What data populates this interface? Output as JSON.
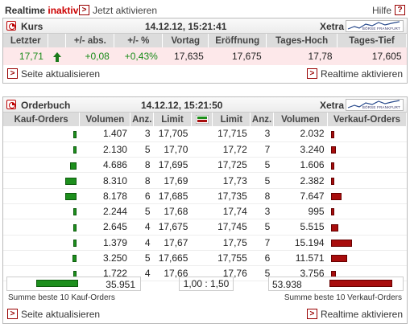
{
  "topbar": {
    "realtime_label": "Realtime",
    "inactive_label": "inaktiv",
    "activate_label": "Jetzt aktivieren",
    "help_label": "Hilfe"
  },
  "kurs": {
    "title": "Kurs",
    "timestamp": "14.12.12, 15:21:41",
    "exchange": "Xetra",
    "logo_text": "BÖRSE FRANKFURT",
    "headers": [
      "Letzter",
      "",
      "+/- abs.",
      "+/- %",
      "Vortag",
      "Eröffnung",
      "Tages-Hoch",
      "Tages-Tief"
    ],
    "values": {
      "last": "17,71",
      "change_abs": "+0,08",
      "change_pct": "+0,43%",
      "prev_close": "17,635",
      "open": "17,675",
      "high": "17,78",
      "low": "17,605"
    },
    "refresh_label": "Seite aktualisieren",
    "realtime_label": "Realtime aktivieren"
  },
  "orderbook": {
    "title": "Orderbuch",
    "timestamp": "14.12.12, 15:21:50",
    "exchange": "Xetra",
    "logo_text": "BÖRSE FRANKFURT",
    "headers": [
      "Kauf-Orders",
      "Volumen",
      "Anz.",
      "Limit",
      "",
      "Limit",
      "Anz.",
      "Volumen",
      "Verkauf-Orders"
    ],
    "rows": [
      {
        "bid_vol": "1.407",
        "bid_cnt": "3",
        "bid_limit": "17,705",
        "ask_limit": "17,715",
        "ask_cnt": "3",
        "ask_vol": "2.032",
        "bid_share": 0.169,
        "ask_share": 0.134
      },
      {
        "bid_vol": "2.130",
        "bid_cnt": "5",
        "bid_limit": "17,70",
        "ask_limit": "17,72",
        "ask_cnt": "7",
        "ask_vol": "3.240",
        "bid_share": 0.256,
        "ask_share": 0.213
      },
      {
        "bid_vol": "4.686",
        "bid_cnt": "8",
        "bid_limit": "17,695",
        "ask_limit": "17,725",
        "ask_cnt": "5",
        "ask_vol": "1.606",
        "bid_share": 0.564,
        "ask_share": 0.106
      },
      {
        "bid_vol": "8.310",
        "bid_cnt": "8",
        "bid_limit": "17,69",
        "ask_limit": "17,73",
        "ask_cnt": "5",
        "ask_vol": "2.382",
        "bid_share": 1.0,
        "ask_share": 0.157
      },
      {
        "bid_vol": "8.178",
        "bid_cnt": "6",
        "bid_limit": "17,685",
        "ask_limit": "17,735",
        "ask_cnt": "8",
        "ask_vol": "7.647",
        "bid_share": 0.984,
        "ask_share": 0.503
      },
      {
        "bid_vol": "2.244",
        "bid_cnt": "5",
        "bid_limit": "17,68",
        "ask_limit": "17,74",
        "ask_cnt": "3",
        "ask_vol": "995",
        "bid_share": 0.27,
        "ask_share": 0.065
      },
      {
        "bid_vol": "2.645",
        "bid_cnt": "4",
        "bid_limit": "17,675",
        "ask_limit": "17,745",
        "ask_cnt": "5",
        "ask_vol": "5.515",
        "bid_share": 0.318,
        "ask_share": 0.363
      },
      {
        "bid_vol": "1.379",
        "bid_cnt": "4",
        "bid_limit": "17,67",
        "ask_limit": "17,75",
        "ask_cnt": "7",
        "ask_vol": "15.194",
        "bid_share": 0.166,
        "ask_share": 1.0
      },
      {
        "bid_vol": "3.250",
        "bid_cnt": "5",
        "bid_limit": "17,665",
        "ask_limit": "17,755",
        "ask_cnt": "6",
        "ask_vol": "11.571",
        "bid_share": 0.391,
        "ask_share": 0.762
      },
      {
        "bid_vol": "1.722",
        "bid_cnt": "4",
        "bid_limit": "17,66",
        "ask_limit": "17,76",
        "ask_cnt": "5",
        "ask_vol": "3.756",
        "bid_share": 0.207,
        "ask_share": 0.247
      }
    ],
    "sum_bid": "35.951",
    "sum_ask": "53.938",
    "ratio": "1,00 : 1,50",
    "sum_bid_label": "Summe beste 10 Kauf-Orders",
    "sum_ask_label": "Summe beste 10 Verkauf-Orders",
    "refresh_label": "Seite aktualisieren",
    "realtime_label": "Realtime aktivieren"
  },
  "colors": {
    "bid_bar": "#1d8f1d",
    "ask_bar": "#a80d0d",
    "accent": "#cc0000",
    "kurs_row_bg": "#fde8ea"
  }
}
